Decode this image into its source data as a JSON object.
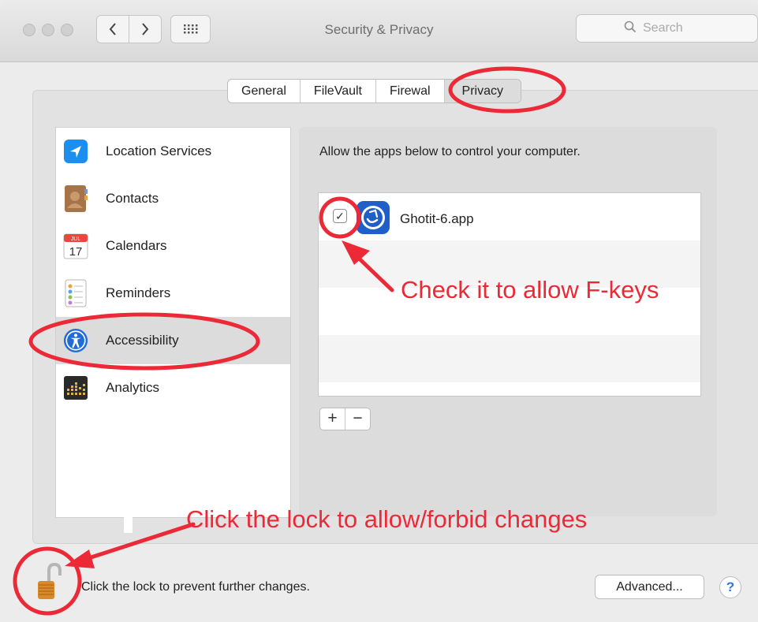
{
  "window": {
    "title": "Security & Privacy"
  },
  "toolbar": {
    "back_icon": "chevron-left-icon",
    "forward_icon": "chevron-right-icon",
    "grid_icon": "grid-icon"
  },
  "search": {
    "placeholder": "Search"
  },
  "tabs": [
    {
      "label": "General",
      "selected": false
    },
    {
      "label": "FileVault",
      "selected": false
    },
    {
      "label": "Firewal",
      "selected": false
    },
    {
      "label": "Privacy",
      "selected": true
    }
  ],
  "sidebar": {
    "items": [
      {
        "label": "Location Services",
        "icon": "location-icon",
        "selected": false
      },
      {
        "label": "Contacts",
        "icon": "contacts-icon",
        "selected": false
      },
      {
        "label": "Calendars",
        "icon": "calendar-icon",
        "selected": false,
        "icon_month": "JUL",
        "icon_day": "17"
      },
      {
        "label": "Reminders",
        "icon": "reminders-icon",
        "selected": false
      },
      {
        "label": "Accessibility",
        "icon": "accessibility-icon",
        "selected": true
      },
      {
        "label": "Analytics",
        "icon": "analytics-icon",
        "selected": false
      }
    ]
  },
  "privacy": {
    "prompt": "Allow the apps below to control your computer.",
    "apps": [
      {
        "name": "Ghotit-6.app",
        "checked": true,
        "icon": "ghotit-app-icon"
      }
    ],
    "add_label": "+",
    "remove_label": "−"
  },
  "footer": {
    "lock_text": "Click the lock to prevent further changes.",
    "lock_icon": "lock-open-icon",
    "advanced_label": "Advanced...",
    "help_label": "?"
  },
  "annotations": {
    "fkeys": "Check it to allow F-keys",
    "lock": "Click the lock to allow/forbid changes",
    "color": "#ec2a37"
  }
}
